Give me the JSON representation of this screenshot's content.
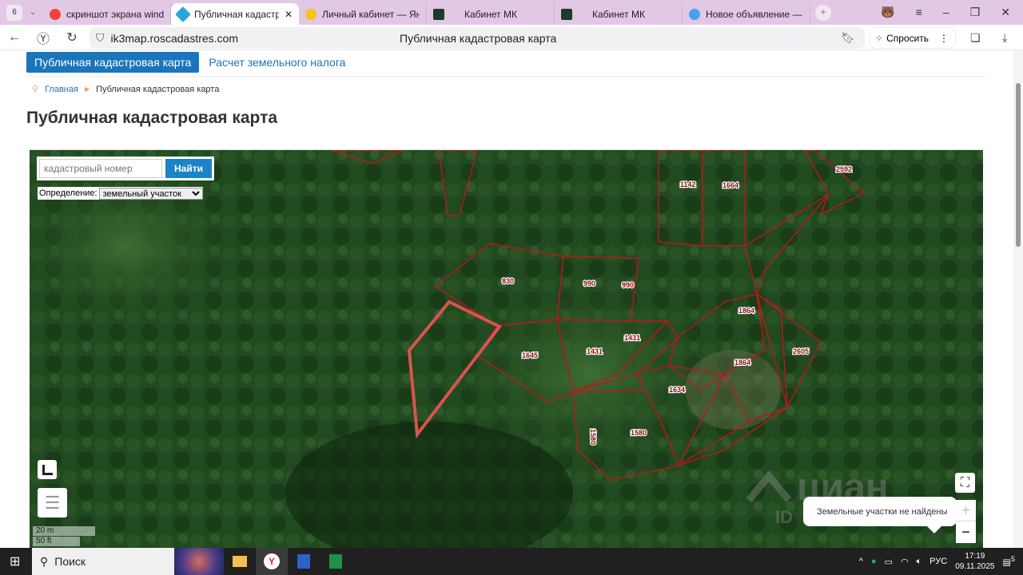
{
  "browser": {
    "tab_count": "6",
    "tabs": [
      {
        "label": "скриншот экрана windows",
        "color": "#f0453a",
        "active": false
      },
      {
        "label": "Публичная кадастровая карта",
        "color": "#2aa6d9",
        "active": true
      },
      {
        "label": "Личный кабинет — Яндекс",
        "color": "#f5c518",
        "active": false
      },
      {
        "label": "Кабинет МК",
        "color": "#1c3b2a",
        "active": false
      },
      {
        "label": "Кабинет МК",
        "color": "#1c3b2a",
        "active": false
      },
      {
        "label": "Новое объявление — Объявления",
        "color": "#4aa0f0",
        "active": false
      }
    ],
    "url": "ik3map.roscadastres.com",
    "page_title": "Публичная кадастровая карта",
    "ask_label": "Спросить"
  },
  "site": {
    "nav": [
      "Публичная кадастровая карта",
      "Расчет земельного налога"
    ],
    "breadcrumbs": [
      "Главная",
      "Публичная кадастровая карта"
    ],
    "heading": "Публичная кадастровая карта"
  },
  "map": {
    "search_placeholder": "кадастровый номер",
    "search_button": "Найти",
    "definition_label": "Определение:",
    "definition_value": "земельный участок",
    "parcel_labels": [
      "1142",
      "1664",
      "2592",
      "830",
      "990",
      "990",
      "1645",
      "1431",
      "1431",
      "1864",
      "1864",
      "2605",
      "1634",
      "1580",
      "1580"
    ],
    "scale_m": "20 m",
    "scale_ft": "50 ft",
    "popup_text": "Земельные участки не найдены",
    "watermark": "циан ID",
    "parcel_color": "#c0151b",
    "selected_color": "#d9534f"
  },
  "taskbar": {
    "search": "Поиск",
    "lang": "РУС",
    "time": "17:19",
    "date": "09.11.2025",
    "notifications": "5"
  }
}
